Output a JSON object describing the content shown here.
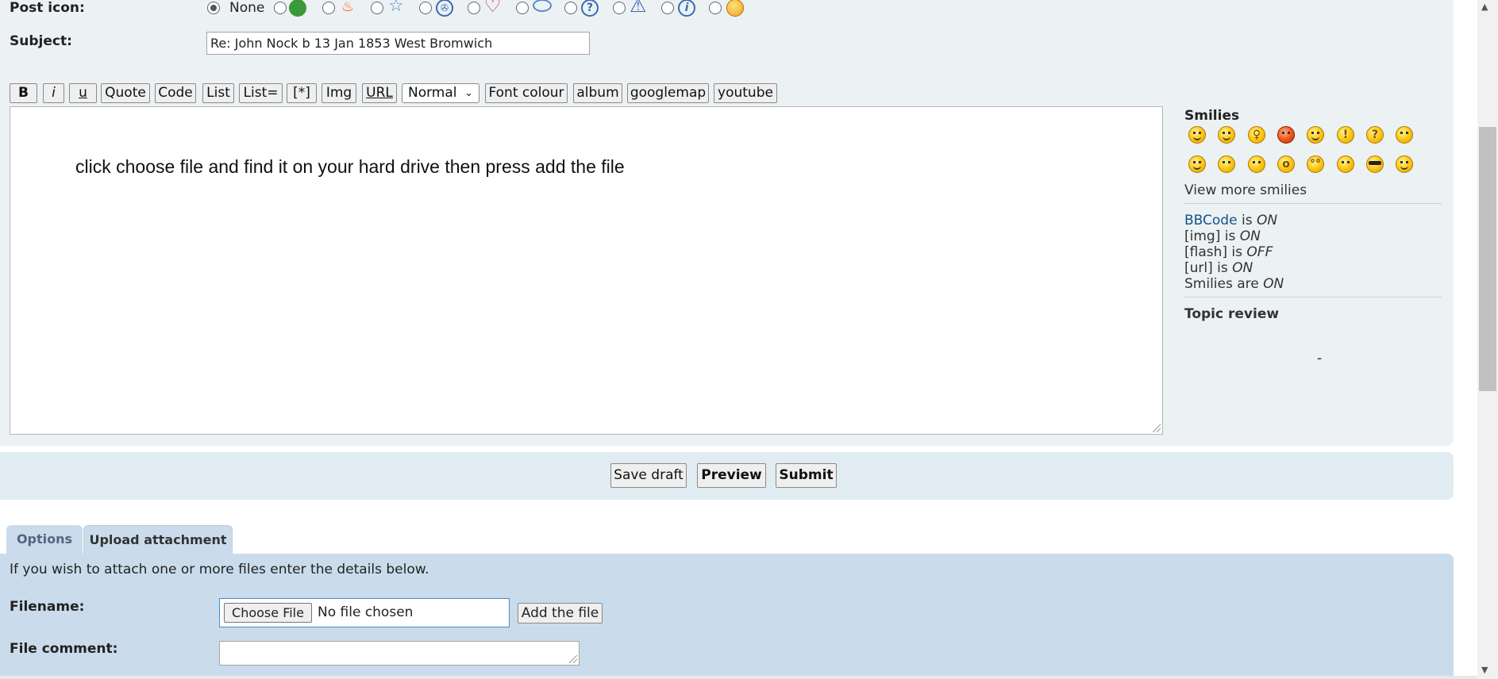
{
  "post_icon": {
    "label": "Post icon:",
    "none_label": "None",
    "options": [
      "none",
      "green-face",
      "fire",
      "star",
      "radioactive",
      "heart",
      "speech-bubble",
      "question",
      "warning",
      "info",
      "sick-face"
    ]
  },
  "subject": {
    "label": "Subject:",
    "value": "Re: John Nock b 13 Jan 1853 West Bromwich"
  },
  "toolbar": {
    "bold": "B",
    "italic": "i",
    "underline": "u",
    "quote": "Quote",
    "code": "Code",
    "list": "List",
    "list_eq": "List=",
    "list_item": "[*]",
    "img": "Img",
    "url": "URL",
    "size_select": "Normal",
    "font_colour": "Font colour",
    "album": "album",
    "googlemap": "googlemap",
    "youtube": "youtube"
  },
  "editor": {
    "text": "click choose file and find it on your hard drive then press add the file"
  },
  "smilies": {
    "title": "Smilies",
    "view_more": "View more smilies"
  },
  "settings": {
    "bbcode_link": "BBCode",
    "bbcode_is": " is ",
    "bbcode_state": "ON",
    "img_label": "[img] is ",
    "img_state": "ON",
    "flash_label": "[flash] is ",
    "flash_state": "OFF",
    "url_label": "[url] is ",
    "url_state": "ON",
    "smilies_label": "Smilies are ",
    "smilies_state": "ON"
  },
  "topic_review": {
    "label": "Topic review",
    "dash": "-"
  },
  "actions": {
    "save_draft": "Save draft",
    "preview": "Preview",
    "submit": "Submit"
  },
  "tabs": {
    "options": "Options",
    "upload": "Upload attachment"
  },
  "attachment": {
    "intro": "If you wish to attach one or more files enter the details below.",
    "filename_label": "Filename:",
    "choose_file": "Choose File",
    "no_file": "No file chosen",
    "add_file": "Add the file",
    "comment_label": "File comment:"
  },
  "colors": {
    "panel": "#ecf1f3",
    "link": "#105289",
    "attach_panel": "#cadceb"
  }
}
